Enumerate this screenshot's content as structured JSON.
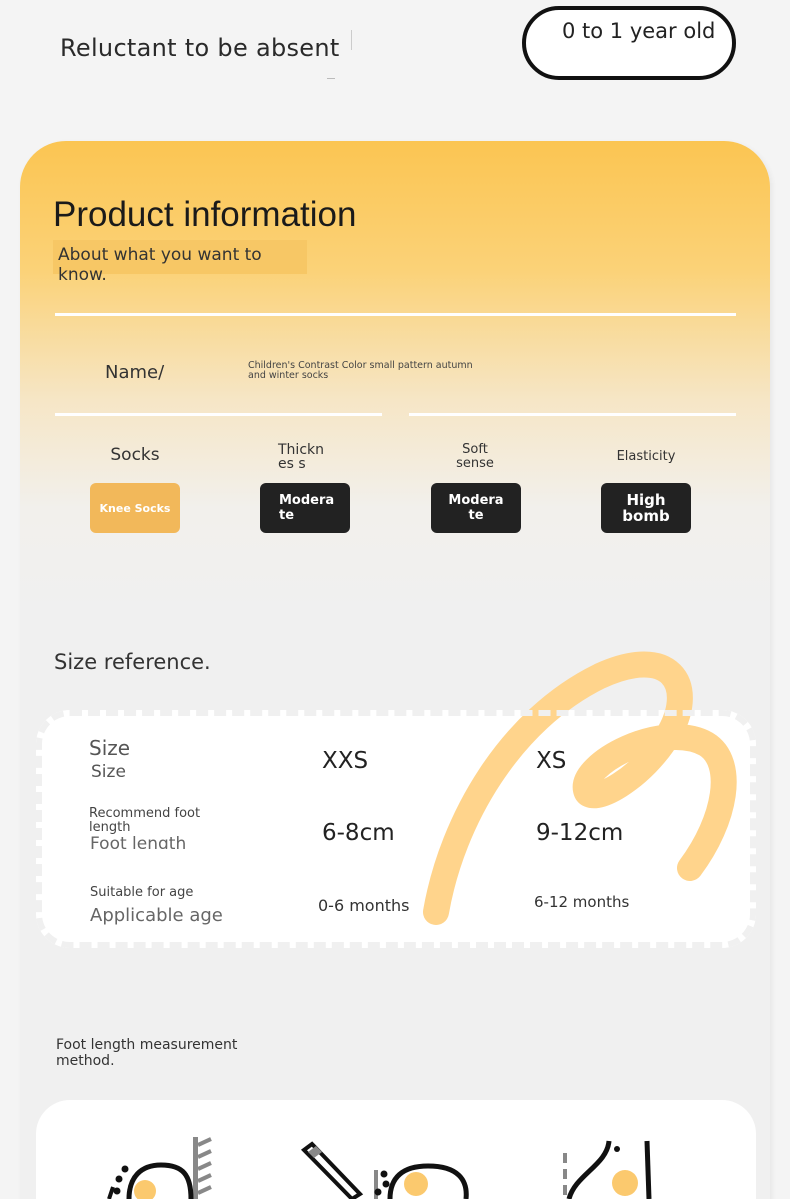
{
  "header": {
    "tagline": "Reluctant to be absent",
    "age_badge": "0 to 1 year old"
  },
  "product_info": {
    "title": "Product information",
    "subtitle": "About what you want to know.",
    "name_label": "Name/",
    "name_value": "Children's Contrast Color small pattern autumn and winter socks",
    "attributes": [
      {
        "label": "Socks",
        "value": "Knee Socks",
        "active": true
      },
      {
        "label": "Thicknes s",
        "value": "Modera te",
        "active": false
      },
      {
        "label": "Soft sense",
        "value": "Modera te",
        "active": false
      },
      {
        "label": "Elasticity",
        "value": "High bomb",
        "active": false
      }
    ]
  },
  "size_reference": {
    "title": "Size reference.",
    "rows": [
      {
        "label_a": "Size",
        "label_b": "Size",
        "xxs": "XXS",
        "xs": "XS"
      },
      {
        "label_a": "Recommend foot length",
        "label_b": "Foot length",
        "xxs": "6-8cm",
        "xs": "9-12cm"
      },
      {
        "label_a": "Suitable for age",
        "label_b": "Applicable age",
        "xxs": "0-6 months",
        "xs": "6-12 months"
      }
    ]
  },
  "measurement": {
    "title": "Foot length measurement method."
  },
  "colors": {
    "accent": "#fbc552",
    "accent_soft": "#f7c765",
    "button_dark": "#222222",
    "button_active": "#f2b85a",
    "ribbon": "#ffd48c"
  }
}
